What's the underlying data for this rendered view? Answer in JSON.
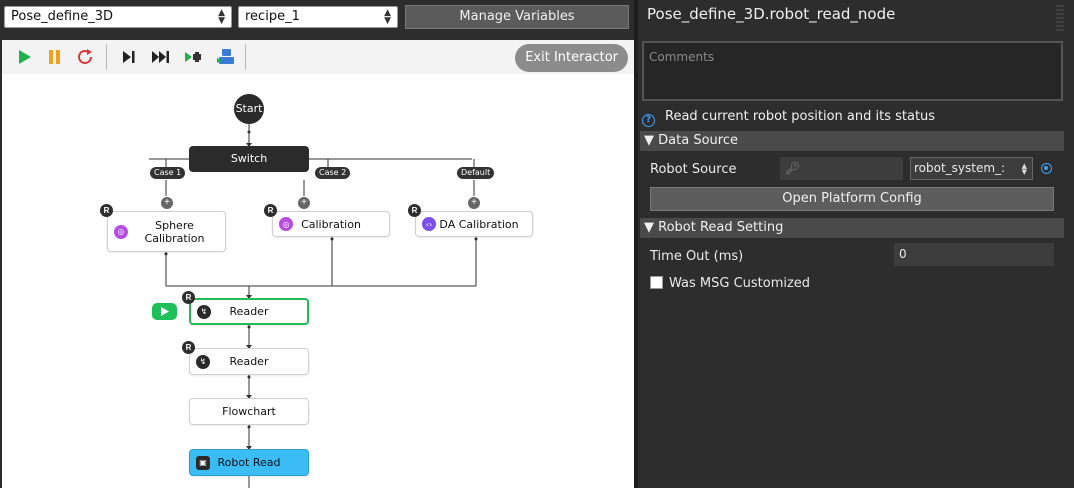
{
  "top_bar": {
    "graph_select": "Pose_define_3D",
    "recipe_select": "recipe_1",
    "manage_variables_label": "Manage Variables"
  },
  "toolbar": {
    "exit_interactor_label": "Exit Interactor",
    "buttons": [
      "play-icon",
      "pause-icon",
      "restart-icon",
      "step-icon",
      "fast-forward-icon",
      "step-into-icon",
      "robot-step-icon"
    ]
  },
  "flowchart": {
    "start_label": "Start",
    "switch_label": "Switch",
    "cases": [
      "Case 1",
      "Case 2",
      "Default"
    ],
    "nodes": {
      "sphere_calibration": "Sphere\nCalibration",
      "calibration": "Calibration",
      "da_calibration": "DA Calibration",
      "reader_1": "Reader",
      "reader_2": "Reader",
      "flowchart": "Flowchart",
      "robot_read": "Robot Read"
    },
    "badge_label": "R",
    "plus_label": "+",
    "colors": {
      "active_border": "#22bb55",
      "selected_fill": "#3bbcf5",
      "run_indicator": "#1fbf5a",
      "icon_purple": "#b44de0",
      "icon_violet": "#7a50e8"
    }
  },
  "properties": {
    "title": "Pose_define_3D.robot_read_node",
    "comments_placeholder": "Comments",
    "description": "Read current robot position and its status",
    "data_source": {
      "header": "Data Source",
      "robot_source_label": "Robot Source",
      "robot_source_value": "robot_system_:",
      "open_platform_config_label": "Open Platform Config"
    },
    "robot_read_setting": {
      "header": "Robot Read Setting",
      "timeout_label": "Time Out (ms)",
      "timeout_value": "0",
      "was_msg_customized_label": "Was MSG Customized"
    }
  }
}
